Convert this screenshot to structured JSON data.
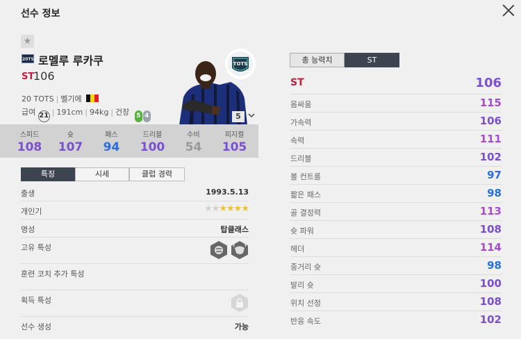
{
  "header": {
    "title": "선수 정보"
  },
  "player": {
    "season_badge": "20TS",
    "name": "로멜루 루카쿠",
    "position": "ST",
    "ovr": "106",
    "season_name": "20 TOTS",
    "nation": "벨기에",
    "wage_label": "급여",
    "wage": "21",
    "height": "191cm",
    "weight": "94kg",
    "build": "건장",
    "left_foot": "5",
    "right_foot": "4",
    "upgrade_level": "5",
    "card_label": "TOTS"
  },
  "stats": [
    {
      "label": "스피드",
      "value": "108",
      "color": "#7a4fd0"
    },
    {
      "label": "슛",
      "value": "107",
      "color": "#7a4fd0"
    },
    {
      "label": "패스",
      "value": "94",
      "color": "#2a6fe0"
    },
    {
      "label": "드리블",
      "value": "100",
      "color": "#7a4fd0"
    },
    {
      "label": "수비",
      "value": "54",
      "color": "#999999"
    },
    {
      "label": "피지컬",
      "value": "105",
      "color": "#7a4fd0"
    }
  ],
  "tabs": [
    "특징",
    "시세",
    "클럽 경력"
  ],
  "info": {
    "birth_label": "출생",
    "birth": "1993.5.13",
    "popularity_label": "개인기",
    "popularity_stars_on": 4,
    "popularity_stars_total": 6,
    "reputation_label": "명성",
    "reputation": "탑클래스",
    "traits_label": "고유 특성",
    "coach_traits_label": "훈련 코치 추가 특성",
    "acquired_traits_label": "획득 특성",
    "creation_label": "선수 생성",
    "creation": "가능"
  },
  "right_tabs": [
    "총 능력치",
    "ST"
  ],
  "attributes": [
    {
      "label": "ST",
      "value": "106"
    },
    {
      "label": "몸싸움",
      "value": "115"
    },
    {
      "label": "가속력",
      "value": "106"
    },
    {
      "label": "속력",
      "value": "111"
    },
    {
      "label": "드리블",
      "value": "102"
    },
    {
      "label": "볼 컨트롤",
      "value": "97"
    },
    {
      "label": "짧은 패스",
      "value": "98"
    },
    {
      "label": "골 결정력",
      "value": "113"
    },
    {
      "label": "슛 파워",
      "value": "108"
    },
    {
      "label": "헤더",
      "value": "114"
    },
    {
      "label": "중거리 슛",
      "value": "98"
    },
    {
      "label": "발리 슛",
      "value": "100"
    },
    {
      "label": "위치 선정",
      "value": "108"
    },
    {
      "label": "반응 속도",
      "value": "102"
    }
  ],
  "colors": {
    "purple": "#7a4fd0",
    "violet": "#a94ad6",
    "blue": "#2a6fe0",
    "red": "#c02040"
  }
}
